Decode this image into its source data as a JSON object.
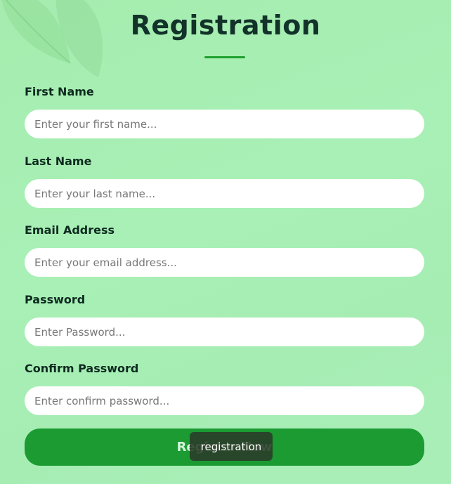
{
  "form": {
    "title": "Registration",
    "fields": [
      {
        "label": "First Name",
        "placeholder": "Enter your first name..."
      },
      {
        "label": "Last Name",
        "placeholder": "Enter your last name..."
      },
      {
        "label": "Email Address",
        "placeholder": "Enter your email address..."
      },
      {
        "label": "Password",
        "placeholder": "Enter Password..."
      },
      {
        "label": "Confirm Password",
        "placeholder": "Enter confirm password..."
      }
    ],
    "submit_label": "Register Now"
  },
  "tooltip": {
    "text": "registration"
  },
  "colors": {
    "background": "#a8eeb4",
    "accent": "#1b9b32",
    "title": "#12322a"
  },
  "icons": {
    "decoration": "leaf-icon"
  }
}
